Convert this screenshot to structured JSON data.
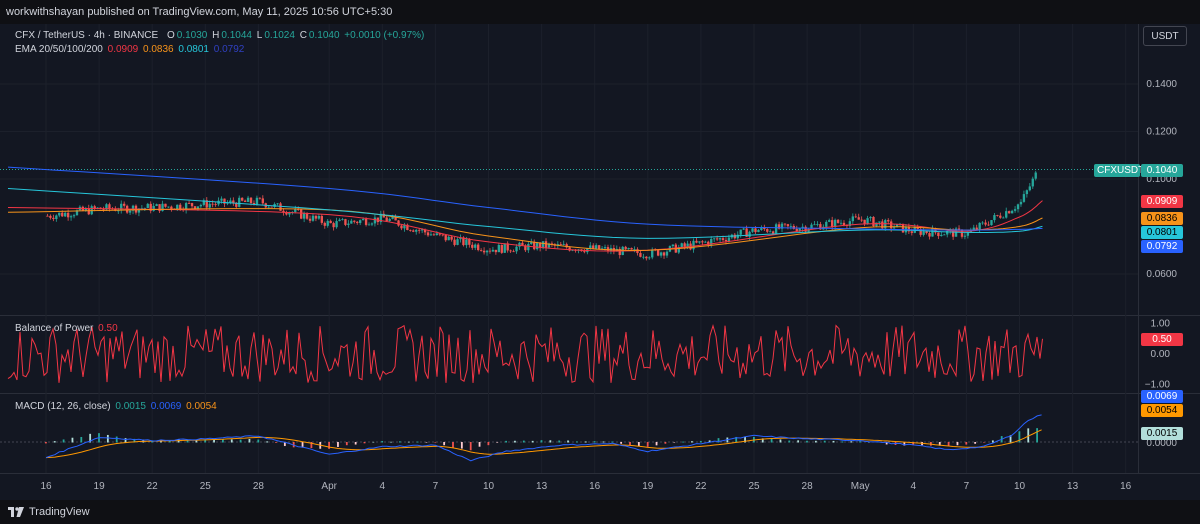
{
  "header": {
    "attribution": "workwithshayan published on TradingView.com, May 11, 2025 10:56 UTC+5:30"
  },
  "footer": {
    "brand": "TradingView"
  },
  "currency_button": "USDT",
  "symbol_legend": {
    "title": "CFX / TetherUS · 4h · BINANCE",
    "o_label": "O",
    "o": "0.1030",
    "h_label": "H",
    "h": "0.1044",
    "l_label": "L",
    "l": "0.1024",
    "c_label": "C",
    "c": "0.1040",
    "change": "+0.0010 (+0.97%)"
  },
  "ema_legend": {
    "title": "EMA 20/50/100/200",
    "v20": "0.0909",
    "v50": "0.0836",
    "v100": "0.0801",
    "v200": "0.0792"
  },
  "bop_legend": {
    "title": "Balance of Power",
    "value": "0.50"
  },
  "macd_legend": {
    "title": "MACD (12, 26, close)",
    "hist": "0.0015",
    "macd": "0.0069",
    "signal": "0.0054"
  },
  "tags": {
    "symbol": "CFXUSDT",
    "last": "0.1040",
    "ema20": "0.0909",
    "ema50": "0.0836",
    "ema100": "0.0801",
    "ema200": "0.0792",
    "bop": "0.50",
    "macd": "0.0069",
    "signal": "0.0054",
    "hist": "0.0015"
  },
  "colors": {
    "up": "#26a69a",
    "down": "#ef5350",
    "ema20": "#f23645",
    "ema50": "#f7931a",
    "ema100": "#26c6da",
    "ema200": "#2962ff",
    "bop": "#f23645",
    "macd": "#2962ff",
    "signal": "#ff9800"
  },
  "chart_data": {
    "type": "line",
    "price_axis": {
      "ticks": [
        "0.1400",
        "0.1200",
        "0.1000",
        "0.0600"
      ],
      "range": [
        0.05,
        0.15
      ]
    },
    "bop_axis": {
      "ticks": [
        "1.00",
        "0.00",
        "−1.00"
      ],
      "range": [
        -1.3,
        1.3
      ]
    },
    "macd_axis": {
      "ticks": [
        "0.0000"
      ]
    },
    "x_ticks": [
      "16",
      "19",
      "22",
      "25",
      "28",
      "Apr",
      "4",
      "7",
      "10",
      "13",
      "16",
      "19",
      "22",
      "25",
      "28",
      "May",
      "4",
      "7",
      "10",
      "13",
      "16"
    ],
    "series": [
      {
        "name": "CFX / TetherUS",
        "style": "candles",
        "x": [
          "16",
          "19",
          "22",
          "25",
          "28",
          "Apr",
          "4",
          "7",
          "10",
          "13",
          "16",
          "19",
          "22",
          "25",
          "28",
          "May",
          "4",
          "7",
          "10",
          "11"
        ],
        "y": [
          0.0845,
          0.0875,
          0.088,
          0.0895,
          0.0905,
          0.081,
          0.0835,
          0.076,
          0.0705,
          0.072,
          0.0705,
          0.0685,
          0.073,
          0.0785,
          0.08,
          0.083,
          0.078,
          0.077,
          0.09,
          0.104
        ]
      },
      {
        "name": "EMA 20",
        "x": [
          "16",
          "Apr",
          "10",
          "19",
          "May",
          "7",
          "10",
          "11"
        ],
        "y": [
          0.088,
          0.085,
          0.0735,
          0.07,
          0.081,
          0.078,
          0.084,
          0.0909
        ]
      },
      {
        "name": "EMA 50",
        "x": [
          "16",
          "Apr",
          "10",
          "19",
          "May",
          "7",
          "10",
          "11"
        ],
        "y": [
          0.086,
          0.087,
          0.076,
          0.07,
          0.0795,
          0.0785,
          0.08,
          0.0836
        ]
      },
      {
        "name": "EMA 100",
        "x": [
          "16",
          "Apr",
          "10",
          "19",
          "May",
          "7",
          "10",
          "11"
        ],
        "y": [
          0.096,
          0.087,
          0.08,
          0.075,
          0.0785,
          0.0775,
          0.078,
          0.0801
        ]
      },
      {
        "name": "EMA 200",
        "x": [
          "16",
          "Apr",
          "10",
          "19",
          "May",
          "7",
          "10",
          "11"
        ],
        "y": [
          0.105,
          0.096,
          0.088,
          0.081,
          0.079,
          0.0785,
          0.0788,
          0.0792
        ]
      }
    ]
  }
}
